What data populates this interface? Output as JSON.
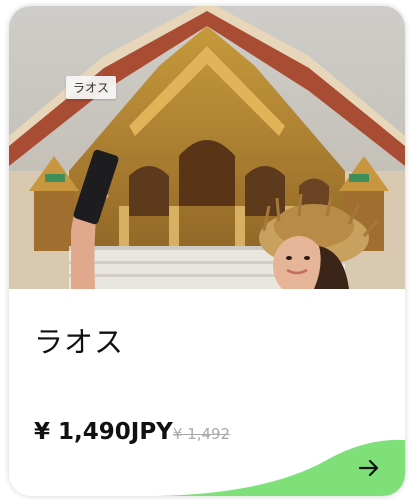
{
  "card": {
    "tag": "ラオス",
    "title": "ラオス",
    "price": "¥ 1,490JPY",
    "old_price": "¥ 1,492",
    "accent_color": "#7fe07a",
    "arrow_icon": "arrow-right-icon"
  }
}
